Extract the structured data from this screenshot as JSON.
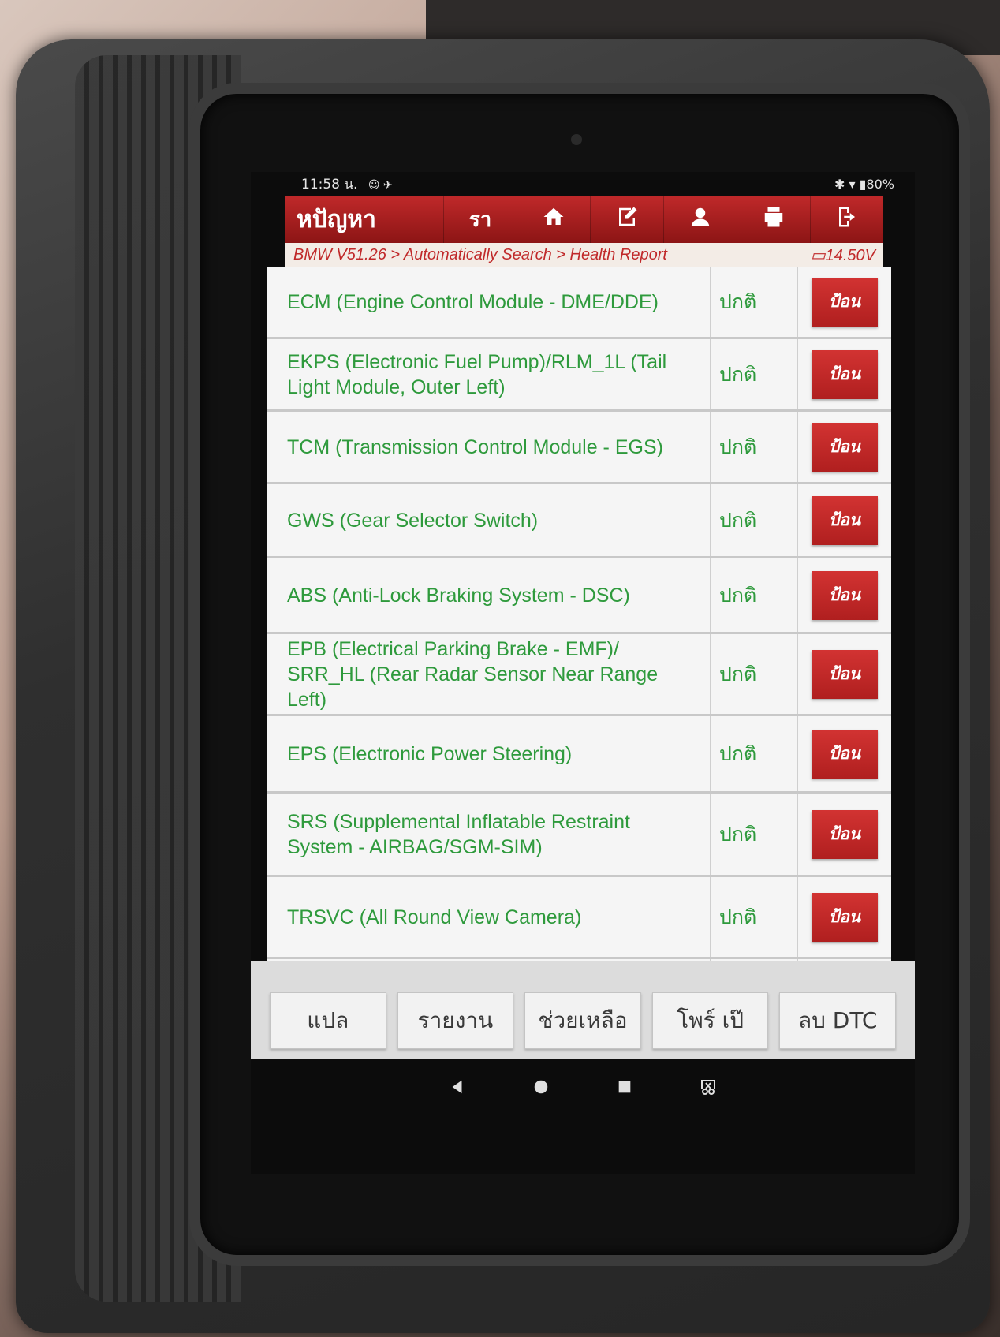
{
  "statusbar": {
    "time": "11:58 น.",
    "left_icons": "☺ ✈",
    "battery": "✱ ▾ ▮80%"
  },
  "toolbar": {
    "title": "หปัญหา",
    "back_label": "รา",
    "icons": [
      "home-icon",
      "edit-icon",
      "profile-icon",
      "print-icon",
      "exit-icon"
    ]
  },
  "breadcrumb": {
    "path": "BMW V51.26 > Automatically Search > Health Report",
    "voltage": "14.50V"
  },
  "modules": [
    {
      "name": "ECM (Engine Control Module - DME/DDE)",
      "status": "ปกติ",
      "action": "ป้อน"
    },
    {
      "name": "EKPS (Electronic Fuel Pump)/RLM_1L (Tail Light Module, Outer Left)",
      "status": "ปกติ",
      "action": "ป้อน"
    },
    {
      "name": "TCM (Transmission Control Module - EGS)",
      "status": "ปกติ",
      "action": "ป้อน"
    },
    {
      "name": "GWS (Gear Selector Switch)",
      "status": "ปกติ",
      "action": "ป้อน"
    },
    {
      "name": "ABS (Anti-Lock Braking System - DSC)",
      "status": "ปกติ",
      "action": "ป้อน"
    },
    {
      "name": "EPB (Electrical Parking Brake - EMF)/ SRR_HL (Rear Radar Sensor Near Range Left)",
      "status": "ปกติ",
      "action": "ป้อน"
    },
    {
      "name": "EPS (Electronic Power Steering)",
      "status": "ปกติ",
      "action": "ป้อน"
    },
    {
      "name": "SRS (Supplemental Inflatable Restraint System - AIRBAG/SGM-SIM)",
      "status": "ปกติ",
      "action": "ป้อน"
    },
    {
      "name": "TRSVC (All Round View Camera)",
      "status": "ปกติ",
      "action": "ป้อน"
    }
  ],
  "bottom_buttons": [
    "แปล",
    "รายงาน",
    "ช่วยเหลือ",
    "โพร์    เป๊",
    "ลบ DTC"
  ],
  "colors": {
    "accent_red": "#c0292a",
    "status_green": "#2e9a3c"
  }
}
